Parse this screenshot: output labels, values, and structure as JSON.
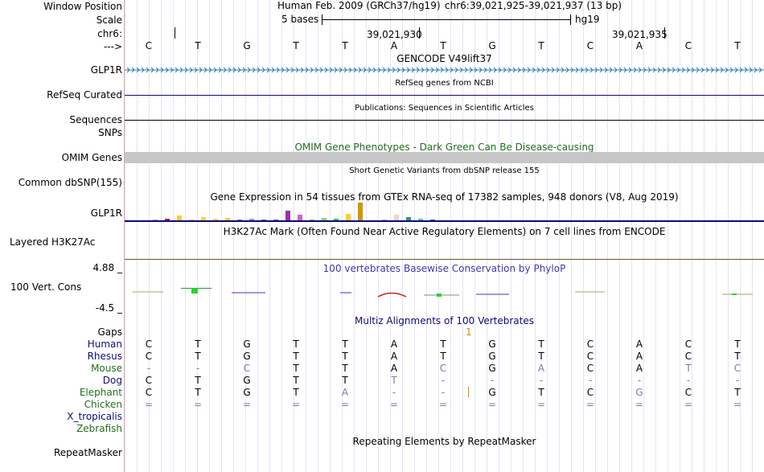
{
  "header": {
    "window_position_label": "Window Position",
    "assembly": "Human Feb. 2009 (GRCh37/hg19)",
    "position": "chr6:39,021,925-39,021,937 (13 bp)",
    "scale_label": "Scale",
    "scale_bases": "5 bases",
    "scale_db": "hg19",
    "chrom_label": "chr6:",
    "coord_1": "39,021,930",
    "coord_2": "39,021,935",
    "strand_label": "--->"
  },
  "sequence": [
    "C",
    "T",
    "G",
    "T",
    "T",
    "A",
    "T",
    "G",
    "T",
    "C",
    "A",
    "C",
    "T"
  ],
  "tracks": {
    "gencode": {
      "title": "GENCODE V49lift37",
      "label": "GLP1R",
      "color": "#2a7bb5"
    },
    "refseq": {
      "title": "RefSeq genes from NCBI",
      "label": "RefSeq Curated",
      "color": "#0c0c78"
    },
    "pubs": {
      "title": "Publications: Sequences in Scientific Articles",
      "label_1": "Sequences",
      "label_2": "SNPs"
    },
    "omim": {
      "title": "OMIM Gene Phenotypes - Dark Green Can Be Disease-causing",
      "label": "OMIM Genes",
      "color": "#1f6e1f"
    },
    "dbsnp": {
      "title": "Short Genetic Variants from dbSNP release 155",
      "label": "Common dbSNP(155)"
    },
    "gtex": {
      "title": "Gene Expression in 54 tissues from GTEx RNA-seq of 17382 samples, 948 donors (V8, Aug 2019)",
      "label": "GLP1R"
    },
    "h3k27ac": {
      "title": "H3K27Ac Mark (Often Found Near Active Regulatory Elements) on 7 cell lines from ENCODE",
      "label": "Layered H3K27Ac"
    },
    "phylop": {
      "title": "100 vertebrates Basewise Conservation by PhyloP",
      "label": "100 Vert. Cons",
      "max": "4.88 _",
      "min": "-4.5 _",
      "color": "#3a3ab0",
      "min_color": "#8b1a1a"
    },
    "multiz": {
      "title": "Multiz Alignments of 100 Vertebrates",
      "gaps_label": "Gaps",
      "gaps_value": "1",
      "gaps_color": "#d48a00"
    },
    "repeatmasker": {
      "title": "Repeating Elements by RepeatMasker",
      "label": "RepeatMasker"
    }
  },
  "species": [
    {
      "name": "Human",
      "color": "#0c0c78",
      "bases": [
        "C",
        "T",
        "G",
        "T",
        "T",
        "A",
        "T",
        "G",
        "T",
        "C",
        "A",
        "C",
        "T"
      ]
    },
    {
      "name": "Rhesus",
      "color": "#0c0c78",
      "bases": [
        "C",
        "T",
        "G",
        "T",
        "T",
        "A",
        "T",
        "G",
        "T",
        "C",
        "A",
        "C",
        "T"
      ]
    },
    {
      "name": "Mouse",
      "color": "#1f6e1f",
      "bases": [
        "-",
        "-",
        "C",
        "T",
        "T",
        "A",
        "C",
        "G",
        "A",
        "C",
        "A",
        "T",
        "C"
      ]
    },
    {
      "name": "Dog",
      "color": "#0c0c78",
      "bases": [
        "C",
        "T",
        "G",
        "T",
        "T",
        "T",
        "-",
        "-",
        "-",
        "-",
        "-",
        "-",
        "-"
      ]
    },
    {
      "name": "Elephant",
      "color": "#1f6e1f",
      "bases": [
        "C",
        "T",
        "G",
        "T",
        "A",
        "-",
        "-",
        "G",
        "T",
        "C",
        "G",
        "C",
        "T"
      ]
    },
    {
      "name": "Chicken",
      "color": "#1f6e1f",
      "bases": [
        "=",
        "=",
        "=",
        "=",
        "=",
        "=",
        "=",
        "=",
        "=",
        "=",
        "=",
        "=",
        "="
      ]
    },
    {
      "name": "X_tropicalis",
      "color": "#0c0c78",
      "bases": []
    },
    {
      "name": "Zebrafish",
      "color": "#1f6e1f",
      "bases": []
    }
  ],
  "gtex_values": [
    0.05,
    0.1,
    0.25,
    0.05,
    0.2,
    0.1,
    0.15,
    0.05,
    0.1,
    0.05,
    0.05,
    0.55,
    0.3,
    0.05,
    0.15,
    0.1,
    0.35,
    1.0,
    0.15,
    0.05,
    0.3,
    0.2,
    0.1,
    0.05
  ]
}
